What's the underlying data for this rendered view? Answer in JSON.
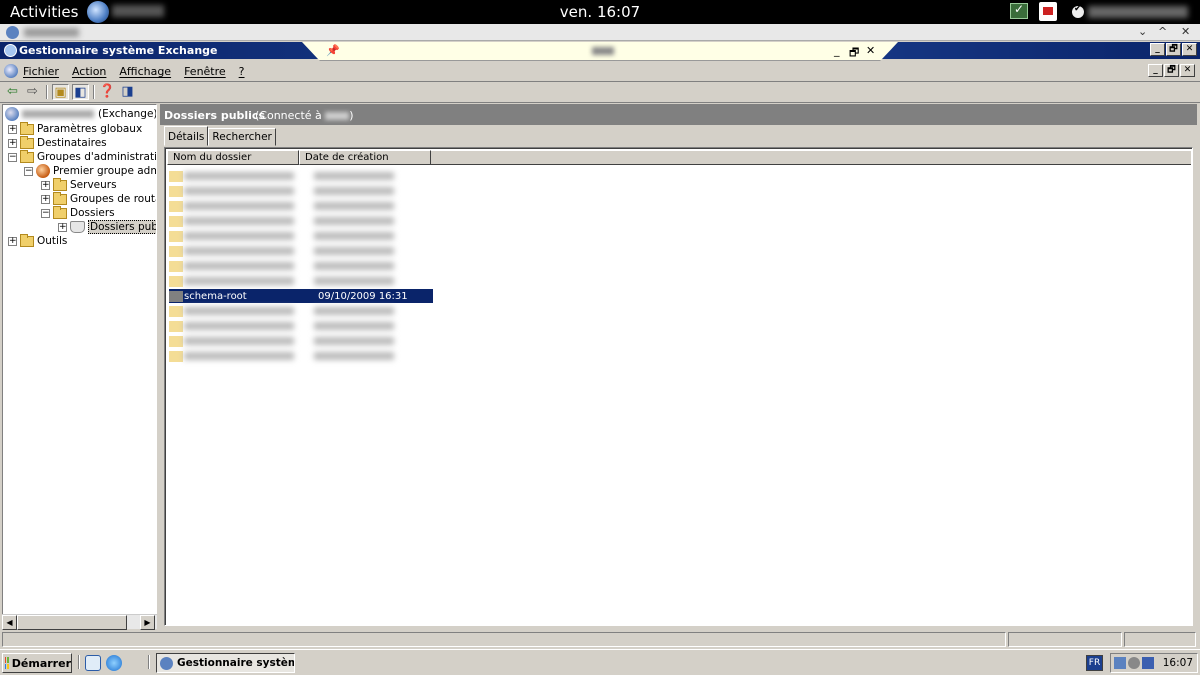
{
  "gnome": {
    "activities": "Activities",
    "clock": "ven. 16:07"
  },
  "window": {
    "title": "Gestionnaire système Exchange",
    "rdp_controls": [
      "_",
      "🗗",
      "✕"
    ],
    "controls": [
      "_",
      "🗗",
      "✕"
    ]
  },
  "outer_controls": [
    "⌄",
    "^",
    "✕"
  ],
  "menu": {
    "items": [
      "Fichier",
      "Action",
      "Affichage",
      "Fenêtre",
      "?"
    ]
  },
  "toolbar": {
    "icons": [
      "back-arrow-icon",
      "forward-arrow-icon",
      "up-folder-icon",
      "show-tree-icon",
      "help-icon",
      "action-pane-icon"
    ]
  },
  "tree": {
    "root_suffix": "(Exchange)",
    "items": [
      {
        "label": "Paramètres globaux",
        "expander": "+"
      },
      {
        "label": "Destinataires",
        "expander": "+"
      },
      {
        "label": "Groupes d'administration",
        "expander": "−"
      },
      {
        "label": "Premier groupe adminis",
        "expander": "−"
      },
      {
        "label": "Serveurs",
        "expander": "+"
      },
      {
        "label": "Groupes de routage",
        "expander": "+"
      },
      {
        "label": "Dossiers",
        "expander": "−"
      },
      {
        "label": "Dossiers publics",
        "expander": "+"
      },
      {
        "label": "Outils",
        "expander": "+"
      }
    ]
  },
  "content": {
    "header_title": "Dossiers publics",
    "connected_prefix": "(Connecté à",
    "connected_suffix": ")",
    "tabs": [
      "Détails",
      "Rechercher"
    ],
    "columns": [
      "Nom du dossier",
      "Date de création"
    ],
    "selected_row": {
      "name": "schema-root",
      "date": "09/10/2009  16:31"
    }
  },
  "taskbar": {
    "start": "Démarrer",
    "task": "Gestionnaire systèm...",
    "lang": "FR",
    "time": "16:07"
  }
}
